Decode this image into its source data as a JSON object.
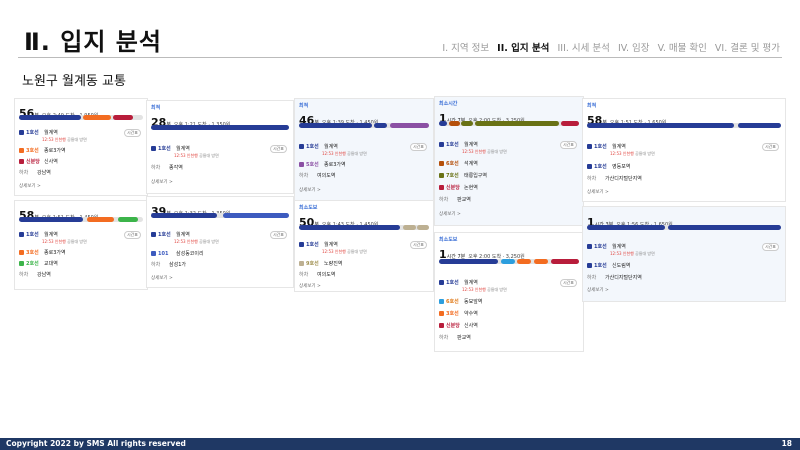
{
  "header": {
    "title": "Ⅱ. 입지 분석",
    "nav": [
      "I. 지역 정보",
      "II. 입지 분석",
      "III. 시세 분석",
      "IV. 임장",
      "V. 매물 확인",
      "VI. 결론 및 평가"
    ]
  },
  "subtitle": "노원구 월계동 교통",
  "common": {
    "unit_min": "분",
    "unit_hour": "시간",
    "timetable": "시간표",
    "detail": "상세보기 >",
    "sub_line": "12:53 인천행",
    "sub_gray": "공릉대 방면",
    "walk": "도보",
    "transfer": "환승",
    "line1": "1호선",
    "line3": "3호선",
    "line2": "2호선",
    "line4": "4호선",
    "line5": "5호선",
    "line6": "6호선",
    "line7": "7호선",
    "line9": "9호선",
    "sinbundang": "신분당",
    "bus101": "101",
    "get_off": "하차",
    "st_wolgye": "월계역",
    "st_jongno3": "종로3가역",
    "st_sinsa": "신사역",
    "st_gangnam": "강남역",
    "st_gyodae": "교대역",
    "st_jongno3b": "종로3가역",
    "st_jonggak": "종각역",
    "st_samseong": "삼성동코이리",
    "st_samseong1": "삼성1가",
    "st_jongno3c": "종로3가역",
    "st_yeouido": "여의도역",
    "st_noryangjin": "노량진역",
    "st_seokgye": "석계역",
    "st_taereung": "태릉입구역",
    "st_nonhyeon": "논현역",
    "st_pangyo": "판교역",
    "st_dongdaemun": "동묘앞역",
    "st_yaksu": "약수역",
    "st_sinsa2": "신사역",
    "st_pangyo2": "판교역",
    "st_yeongdeungpo": "영등포역",
    "st_gasan": "가산디지털단지역",
    "st_sindorim": "신도림역",
    "st_gasan2": "가산디지털단지역"
  },
  "cards": [
    {
      "id": "c1",
      "tag": "",
      "big": "56",
      "unit": "분",
      "info": "오후 2:49 도착 · 1,950원"
    },
    {
      "id": "c2",
      "tag": "",
      "big": "58",
      "unit": "분",
      "info": "오후 1:51 도착 · 1,450원"
    },
    {
      "id": "c3",
      "tag": "최적",
      "big": "28",
      "unit": "분",
      "info": "오후 1:21 도착 · 1,350원"
    },
    {
      "id": "c4",
      "tag": "",
      "big": "39",
      "unit": "분",
      "info": "오후 1:32 도착 · 1,350원"
    },
    {
      "id": "c5",
      "tag": "최적",
      "big": "46",
      "unit": "분",
      "info": "오후 1:39 도착 · 1,450원"
    },
    {
      "id": "c6",
      "tag": "최소도보",
      "big": "50",
      "unit": "분",
      "info": "오후 1:43 도착 · 1,450원"
    },
    {
      "id": "c7",
      "tag": "최소시간",
      "big": "1",
      "unit": "시간 7분",
      "info": "오후 2:00 도착 · 3,250원"
    },
    {
      "id": "c8",
      "tag": "최소도보",
      "big": "1",
      "unit": "시간 7분",
      "info": "오후 2:00 도착 · 3,250원"
    },
    {
      "id": "c9",
      "tag": "최적",
      "big": "58",
      "unit": "분",
      "info": "오후 1:51 도착 · 1,650원"
    },
    {
      "id": "c10",
      "tag": "",
      "big": "1",
      "unit": "시간 3분",
      "info": "오후 1:56 도착 · 1,650원"
    }
  ],
  "colors": {
    "line1": "#263c96",
    "line2": "#3cb44a",
    "line3": "#f36c21",
    "line4": "#2c9ede",
    "line5": "#8b50a4",
    "line6": "#b5500b",
    "line7": "#697215",
    "line9": "#bdb092",
    "sinbundang": "#b81d3b",
    "bus": "#3d5bbf"
  },
  "footer": {
    "copyright": "Copyright 2022 by SMS All rights reserved",
    "page": "18"
  }
}
